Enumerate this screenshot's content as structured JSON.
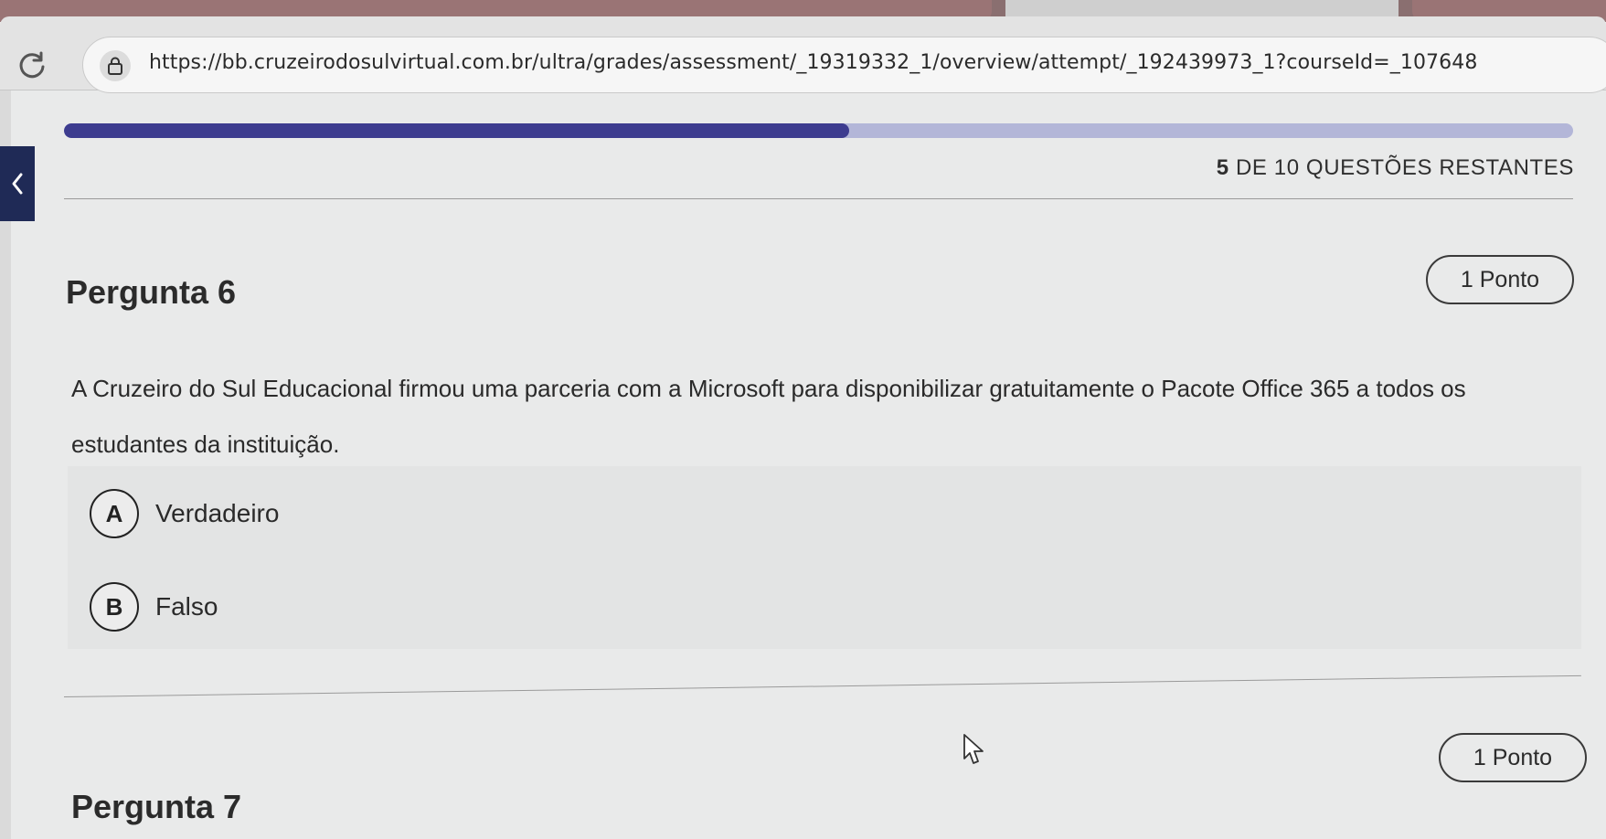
{
  "browser": {
    "url": "https://bb.cruzeirodosulvirtual.com.br/ultra/grades/assessment/_19319332_1/overview/attempt/_192439973_1?courseId=_107648",
    "icons": {
      "reload": "reload-icon",
      "lock": "lock-icon"
    }
  },
  "progress": {
    "current": 5,
    "total": 10,
    "fraction": 0.52,
    "remaining_number": "5",
    "remaining_text": "DE 10 QUESTÕES RESTANTES",
    "track_color": "#b3b6d8",
    "fill_color": "#3d3c8f"
  },
  "nav": {
    "back_icon": "chevron-left-icon",
    "back_color": "#1f2a56"
  },
  "question6": {
    "title": "Pergunta 6",
    "points": "1 Ponto",
    "text": "A Cruzeiro do Sul Educacional firmou uma parceria com a Microsoft para disponibilizar gratuitamente o Pacote Office 365 a todos os estudantes da instituição.",
    "options": [
      {
        "letter": "A",
        "label": "Verdadeiro"
      },
      {
        "letter": "B",
        "label": "Falso"
      }
    ]
  },
  "question7": {
    "title": "Pergunta 7",
    "points": "1 Ponto"
  }
}
